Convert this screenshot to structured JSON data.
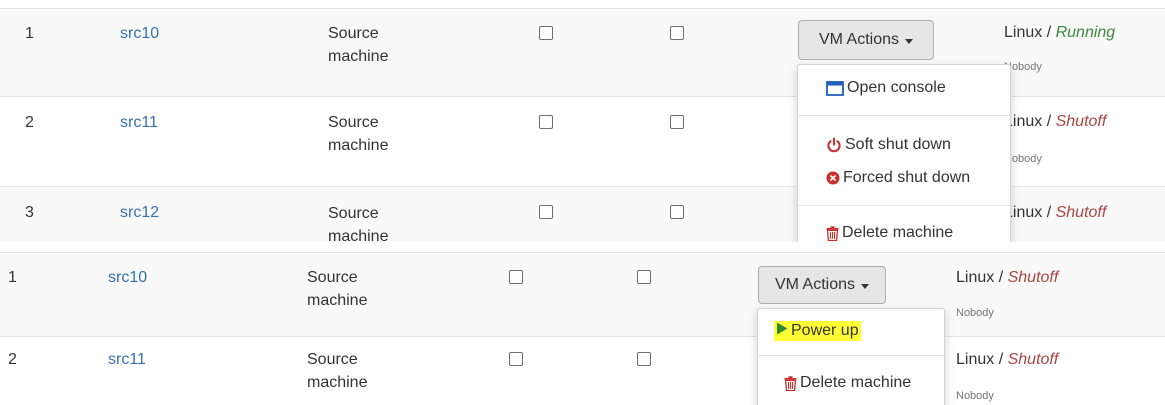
{
  "top_panel": {
    "rows": [
      {
        "index": "1",
        "name": "src10",
        "description": "Source machine",
        "os": "Linux",
        "sep": " / ",
        "state": "Running",
        "owner": "Nobody"
      },
      {
        "index": "2",
        "name": "src11",
        "description": "Source machine",
        "os": "Linux",
        "sep": " / ",
        "state": "Shutoff",
        "owner": "Nobody"
      },
      {
        "index": "3",
        "name": "src12",
        "description": "Source machine",
        "os": "Linux",
        "sep": " / ",
        "state": "Shutoff"
      }
    ],
    "actions_button": "VM Actions",
    "menu": {
      "open_console": "Open console",
      "soft_shut_down": "Soft shut down",
      "forced_shut_down": "Forced shut down",
      "delete_machine": "Delete machine"
    }
  },
  "bottom_panel": {
    "rows": [
      {
        "index": "1",
        "name": "src10",
        "description": "Source machine",
        "os": "Linux",
        "sep": " / ",
        "state": "Shutoff",
        "owner": "Nobody"
      },
      {
        "index": "2",
        "name": "src11",
        "description": "Source machine",
        "os": "Linux",
        "sep": " / ",
        "state": "Shutoff",
        "owner": "Nobody"
      }
    ],
    "actions_button": "VM Actions",
    "menu": {
      "power_up": "Power up",
      "delete_machine": "Delete machine"
    }
  },
  "colors": {
    "link": "#3471b3",
    "running": "#3c8a3c",
    "shutoff": "#a94442",
    "highlight": "#ffff33",
    "power_up_icon": "#2f8a2f"
  },
  "icons": {
    "open_console": "window-icon",
    "soft_shut_down": "power-icon",
    "forced_shut_down": "circle-x-icon",
    "delete_machine": "trash-icon",
    "power_up": "play-icon"
  }
}
